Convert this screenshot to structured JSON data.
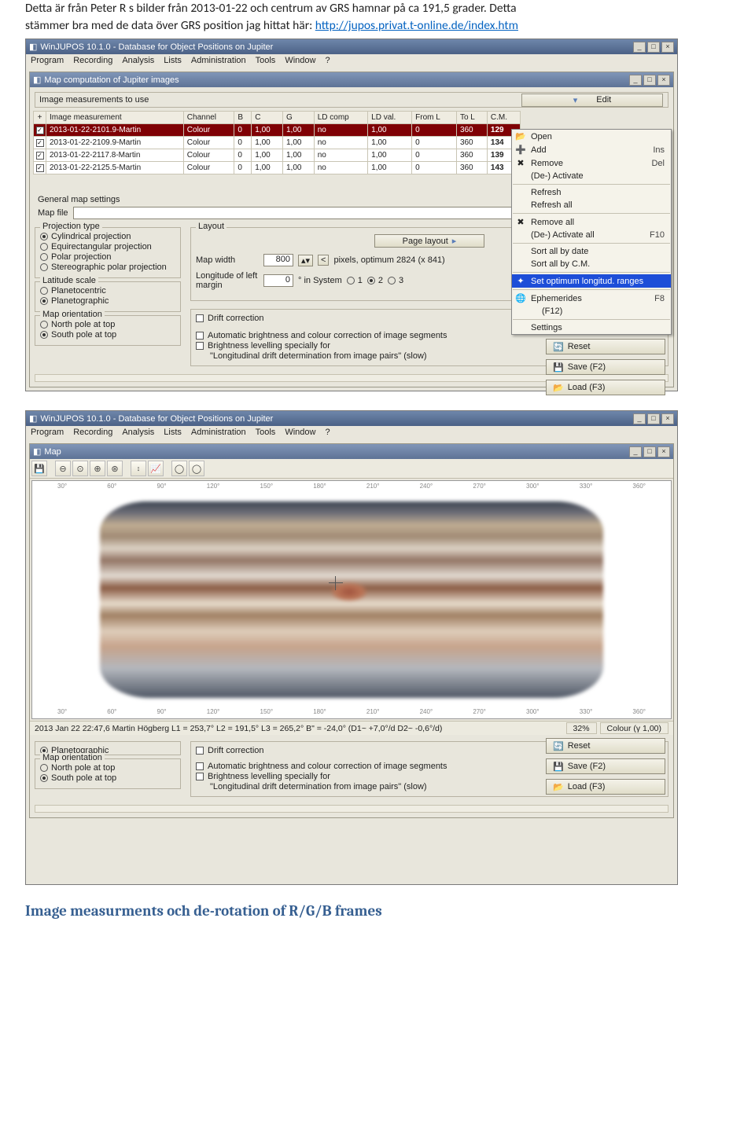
{
  "para1_a": "Detta är från Peter R s bilder från 2013-01-22 och centrum av GRS hamnar på ca 191,5 grader. Detta",
  "para1_b": "stämmer bra med de data över GRS position jag hittat här: ",
  "link_text": "http://jupos.privat.t-online.de/index.htm",
  "heading2": "Image measurments och de-rotation of R/G/B frames",
  "app": {
    "title": "WinJUPOS 10.1.0 - Database for Object Positions on Jupiter",
    "menus": [
      "Program",
      "Recording",
      "Analysis",
      "Lists",
      "Administration",
      "Tools",
      "Window",
      "?"
    ]
  },
  "win1": {
    "title": "Map computation of Jupiter images",
    "measure_label": "Image measurements to use",
    "edit_label": "Edit",
    "headers": [
      "+",
      "Image measurement",
      "Channel",
      "B",
      "C",
      "G",
      "LD comp",
      "LD val.",
      "From L",
      "To L",
      "C.M."
    ],
    "rows": [
      {
        "chk": true,
        "cells": [
          "2013-01-22-2101.9-Martin",
          "Colour",
          "0",
          "1,00",
          "1,00",
          "no",
          "1,00",
          "0",
          "360",
          "129"
        ],
        "selected": true
      },
      {
        "chk": true,
        "cells": [
          "2013-01-22-2109.9-Martin",
          "Colour",
          "0",
          "1,00",
          "1,00",
          "no",
          "1,00",
          "0",
          "360",
          "134"
        ],
        "selected": false
      },
      {
        "chk": true,
        "cells": [
          "2013-01-22-2117.8-Martin",
          "Colour",
          "0",
          "1,00",
          "1,00",
          "no",
          "1,00",
          "0",
          "360",
          "139"
        ],
        "selected": false
      },
      {
        "chk": true,
        "cells": [
          "2013-01-22-2125.5-Martin",
          "Colour",
          "0",
          "1,00",
          "1,00",
          "no",
          "1,00",
          "0",
          "360",
          "143"
        ],
        "selected": false
      }
    ],
    "general": "General map settings",
    "mapfile_label": "Map file",
    "proj": {
      "title": "Projection type",
      "opts": [
        "Cylindrical projection",
        "Equirectangular projection",
        "Polar projection",
        "Stereographic polar projection"
      ],
      "sel": 0
    },
    "lat": {
      "title": "Latitude scale",
      "opts": [
        "Planetocentric",
        "Planetographic"
      ],
      "sel": 1
    },
    "orient": {
      "title": "Map orientation",
      "opts": [
        "North pole at top",
        "South pole at top"
      ],
      "sel": 1
    },
    "layout": {
      "title": "Layout",
      "page_layout": "Page layout",
      "mapwidth_lbl": "Map width",
      "mapwidth_val": "800",
      "pixels_note": "pixels, optimum 2824 (x 841)",
      "long_lbl": "Longitude of left margin",
      "long_val": "0",
      "insys": "° in System",
      "sys_sel": "2",
      "drift": "Drift correction",
      "autobright": "Automatic brightness and colour correction of image segments",
      "bright_lvl": "Brightness levelling specially for",
      "long_drift": "\"Longitudinal drift determination from image pairs\" (slow)"
    },
    "menu": [
      {
        "t": "Open",
        "i": "open"
      },
      {
        "t": "Add",
        "i": "add",
        "sc": "Ins"
      },
      {
        "t": "Remove",
        "i": "remove",
        "sc": "Del"
      },
      {
        "t": "(De-) Activate",
        "i": ""
      },
      {
        "sep": true
      },
      {
        "t": "Refresh",
        "i": ""
      },
      {
        "t": "Refresh all",
        "i": ""
      },
      {
        "sep": true
      },
      {
        "t": "Remove all",
        "i": "remove"
      },
      {
        "t": "(De-) Activate all",
        "i": "",
        "sc": "F10"
      },
      {
        "sep": true
      },
      {
        "t": "Sort all by date",
        "i": ""
      },
      {
        "t": "Sort all by C.M.",
        "i": ""
      },
      {
        "sep": true
      },
      {
        "t": "Set optimum longitud. ranges",
        "i": "star",
        "hl": true
      },
      {
        "sep": true
      },
      {
        "t": "Ephemerides",
        "i": "globe",
        "sc": "F8"
      },
      {
        "t": "(F12)",
        "i": "",
        "indent": true
      },
      {
        "sep": true
      },
      {
        "t": "Settings",
        "i": ""
      }
    ],
    "side": [
      {
        "t": "Reset",
        "i": "reset"
      },
      {
        "t": "Save (F2)",
        "i": "save"
      },
      {
        "t": "Load (F3)",
        "i": "load"
      }
    ]
  },
  "win2": {
    "title": "Map",
    "ticks": [
      "30°",
      "60°",
      "90°",
      "120°",
      "150°",
      "180°",
      "210°",
      "240°",
      "270°",
      "300°",
      "330°",
      "360°"
    ],
    "status": "2013 Jan 22  22:47,6   Martin Högberg   L1 = 253,7°  L2 = 191,5°  L3 = 265,2°  B\" = -24,0°  (D1~  +7,0°/d   D2~  -0,6°/d)",
    "zoom": "32%",
    "mode": "Colour (γ 1,00)",
    "latgrp": {
      "title": "",
      "opt": "Planetographic"
    },
    "orient": {
      "title": "Map orientation",
      "opts": [
        "North pole at top",
        "South pole at top"
      ],
      "sel": 1
    },
    "layout": {
      "drift": "Drift correction",
      "autobright": "Automatic brightness and colour correction of image segments",
      "bright_lvl": "Brightness levelling specially for",
      "long_drift": "\"Longitudinal drift determination from image pairs\" (slow)"
    },
    "side": [
      {
        "t": "Reset",
        "i": "reset"
      },
      {
        "t": "Save (F2)",
        "i": "save"
      },
      {
        "t": "Load (F3)",
        "i": "load"
      }
    ]
  }
}
